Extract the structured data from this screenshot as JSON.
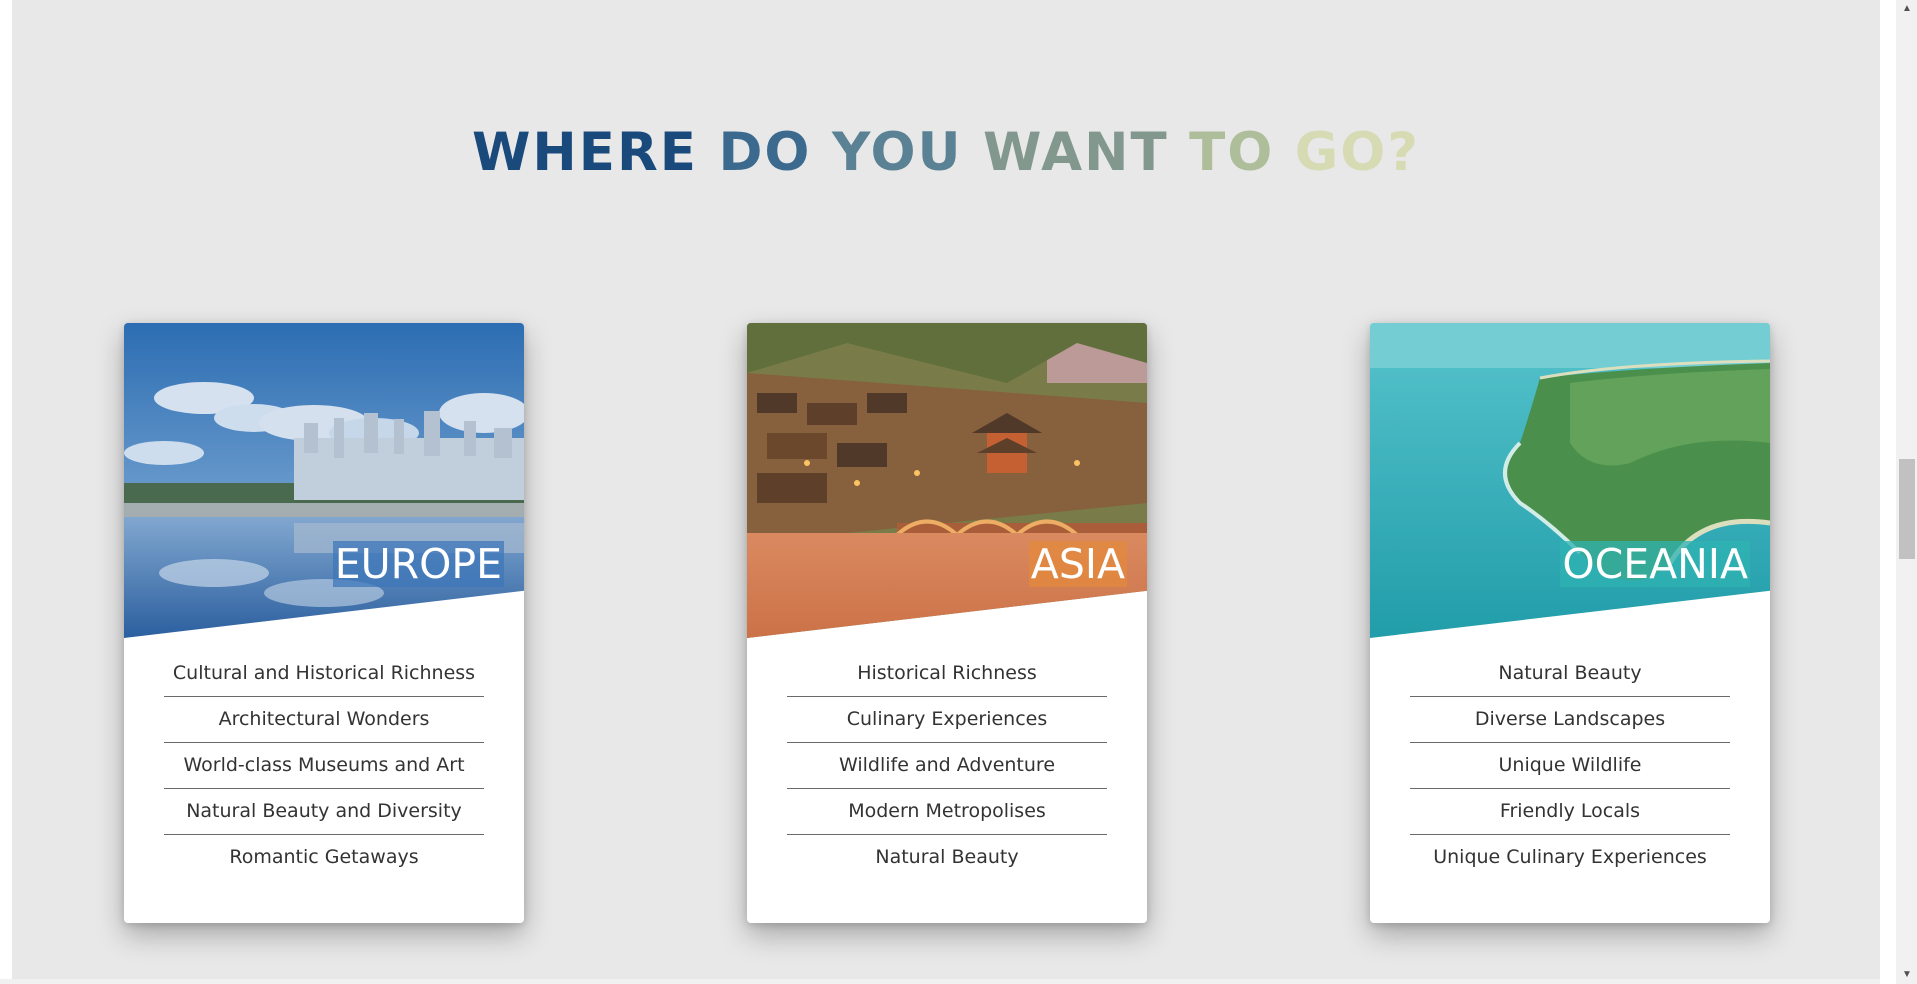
{
  "heading": {
    "words": [
      {
        "text": "WHERE",
        "color": "#1a4a7c"
      },
      {
        "text": "DO",
        "color": "#3c6a8f"
      },
      {
        "text": "YOU",
        "color": "#5b8194"
      },
      {
        "text": "WANT",
        "color": "#82988f"
      },
      {
        "text": "TO",
        "color": "#aebd9a"
      },
      {
        "text": "GO?",
        "color": "#d7dbb4"
      }
    ]
  },
  "cards": [
    {
      "region": "EUROPE",
      "tag_color": "#3f77b9",
      "image": "castle-lake-photo",
      "features": [
        "Cultural and Historical Richness",
        "Architectural Wonders",
        "World-class Museums and Art",
        "Natural Beauty and Diversity",
        "Romantic Getaways"
      ]
    },
    {
      "region": "ASIA",
      "tag_color": "#e38a3c",
      "image": "riverside-town-photo",
      "features": [
        "Historical Richness",
        "Culinary Experiences",
        "Wildlife and Adventure",
        "Modern Metropolises",
        "Natural Beauty"
      ]
    },
    {
      "region": "OCEANIA",
      "tag_color": "#2fb3b3",
      "image": "coastal-headland-photo",
      "features": [
        "Natural Beauty",
        "Diverse Landscapes",
        "Unique Wildlife",
        "Friendly Locals",
        "Unique Culinary Experiences"
      ]
    }
  ],
  "scrollbar": {
    "up_arrow_icon": "triangle-up-icon",
    "down_arrow_icon": "triangle-down-icon"
  }
}
